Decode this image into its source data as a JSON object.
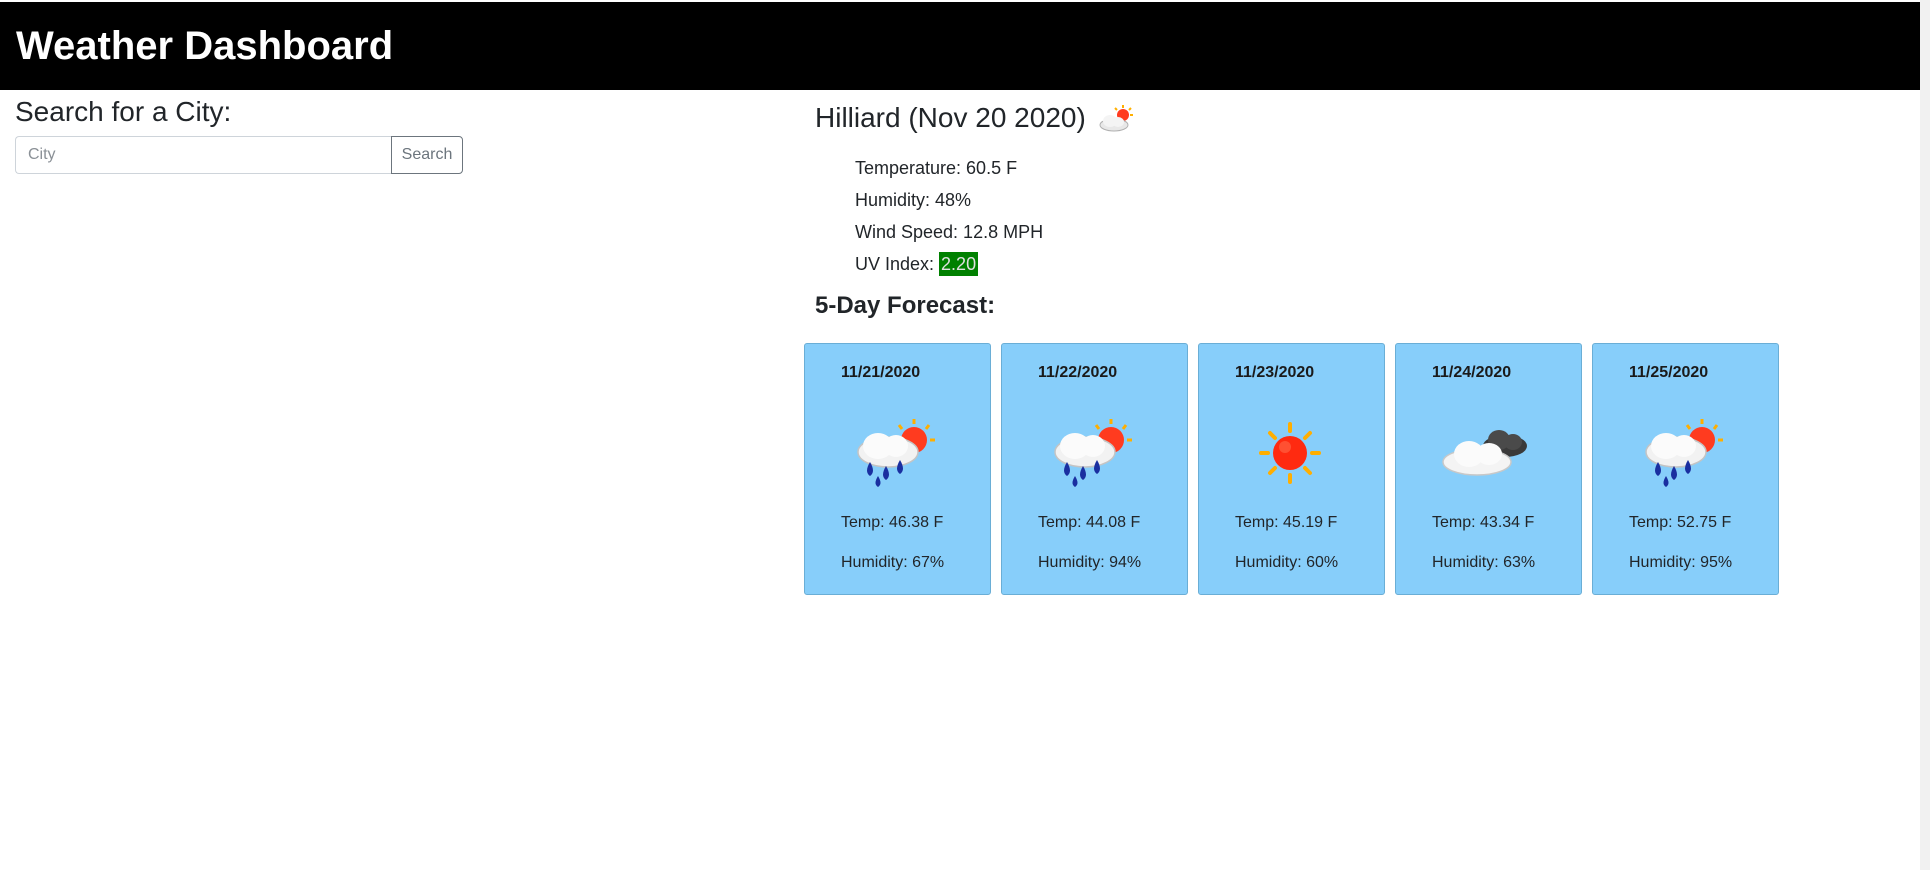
{
  "header": {
    "title": "Weather Dashboard"
  },
  "search": {
    "label": "Search for a City:",
    "placeholder": "City",
    "value": "",
    "button_label": "Search"
  },
  "current": {
    "title": "Hilliard (Nov 20 2020)",
    "icon": "partly-cloudy-sun-icon",
    "temperature": "Temperature: 60.5 F",
    "humidity": "Humidity: 48%",
    "wind": "Wind Speed: 12.8 MPH",
    "uv_label": "UV Index: ",
    "uv_value": "2.20",
    "uv_color": "#008000"
  },
  "forecast": {
    "title": "5-Day Forecast:",
    "card_color": "#87cefa",
    "days": [
      {
        "date": "11/21/2020",
        "icon": "rain-sun-icon",
        "temp": "Temp: 46.38 F",
        "humidity": "Humidity: 67%"
      },
      {
        "date": "11/22/2020",
        "icon": "rain-sun-icon",
        "temp": "Temp: 44.08 F",
        "humidity": "Humidity: 94%"
      },
      {
        "date": "11/23/2020",
        "icon": "sun-icon",
        "temp": "Temp: 45.19 F",
        "humidity": "Humidity: 60%"
      },
      {
        "date": "11/24/2020",
        "icon": "cloudy-icon",
        "temp": "Temp: 43.34 F",
        "humidity": "Humidity: 63%"
      },
      {
        "date": "11/25/2020",
        "icon": "rain-sun-icon",
        "temp": "Temp: 52.75 F",
        "humidity": "Humidity: 95%"
      }
    ]
  }
}
